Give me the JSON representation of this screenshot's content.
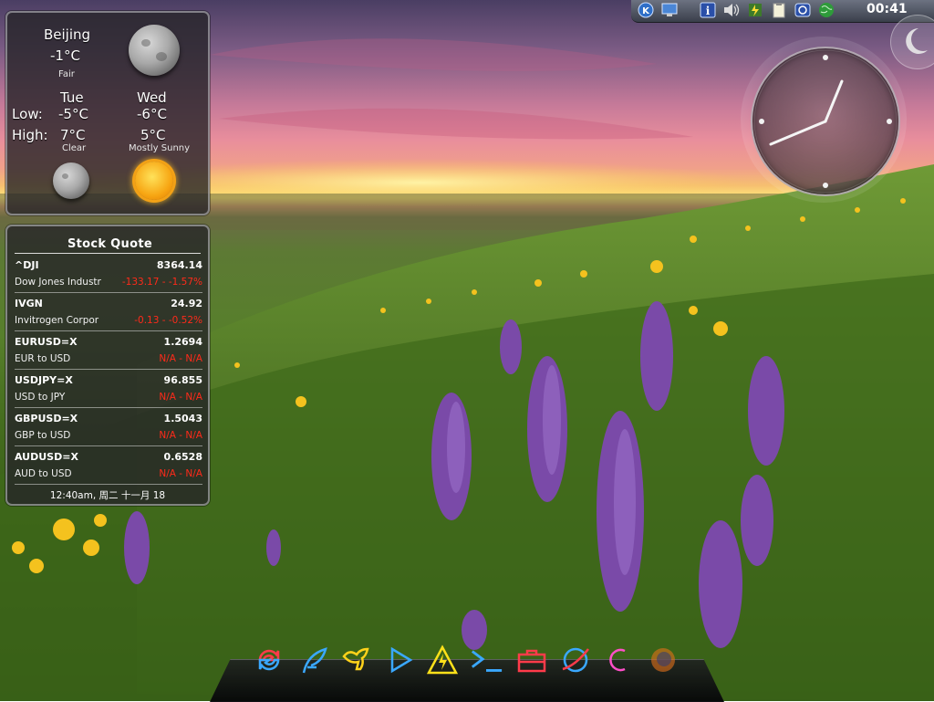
{
  "weather": {
    "city": "Beijing",
    "temp_now": "-1°C",
    "condition_now": "Fair",
    "days": [
      {
        "name": "Tue",
        "low": "-5°C",
        "high": "7°C",
        "condition": "Clear",
        "icon": "moon-icon"
      },
      {
        "name": "Wed",
        "low": "-6°C",
        "high": "5°C",
        "condition": "Mostly Sunny",
        "icon": "sun-icon"
      }
    ],
    "low_label": "Low:",
    "high_label": "High:"
  },
  "stocks": {
    "title": "Stock Quote",
    "rows": [
      {
        "symbol": "^DJI",
        "price": "8364.14",
        "name": "Dow Jones Industr",
        "change": "-133.17 - -1.57%"
      },
      {
        "symbol": "IVGN",
        "price": "24.92",
        "name": "Invitrogen Corpor",
        "change": "-0.13 - -0.52%"
      },
      {
        "symbol": "EURUSD=X",
        "price": "1.2694",
        "name": "EUR to USD",
        "change": "N/A - N/A"
      },
      {
        "symbol": "USDJPY=X",
        "price": "96.855",
        "name": "USD to JPY",
        "change": "N/A - N/A"
      },
      {
        "symbol": "GBPUSD=X",
        "price": "1.5043",
        "name": "GBP to USD",
        "change": "N/A - N/A"
      },
      {
        "symbol": "AUDUSD=X",
        "price": "0.6528",
        "name": "AUD to USD",
        "change": "N/A - N/A"
      }
    ],
    "updated": "12:40am, 周二 十一月 18"
  },
  "tray": {
    "time": "00:41",
    "icons": [
      "kde-menu-icon",
      "desktop-icon",
      "info-icon",
      "volume-icon",
      "battery-icon",
      "clipboard-icon",
      "network-icon",
      "globe-icon"
    ]
  },
  "dock": {
    "icons": [
      "refresh-icon",
      "feather-icon",
      "pegasus-icon",
      "play-icon",
      "warning-icon",
      "terminal-icon",
      "toolbox-icon",
      "browser-icon",
      "power-icon",
      "firefox-icon"
    ]
  },
  "colors": {
    "negative": "#ff2a1a",
    "panel_bg": "#262428"
  }
}
